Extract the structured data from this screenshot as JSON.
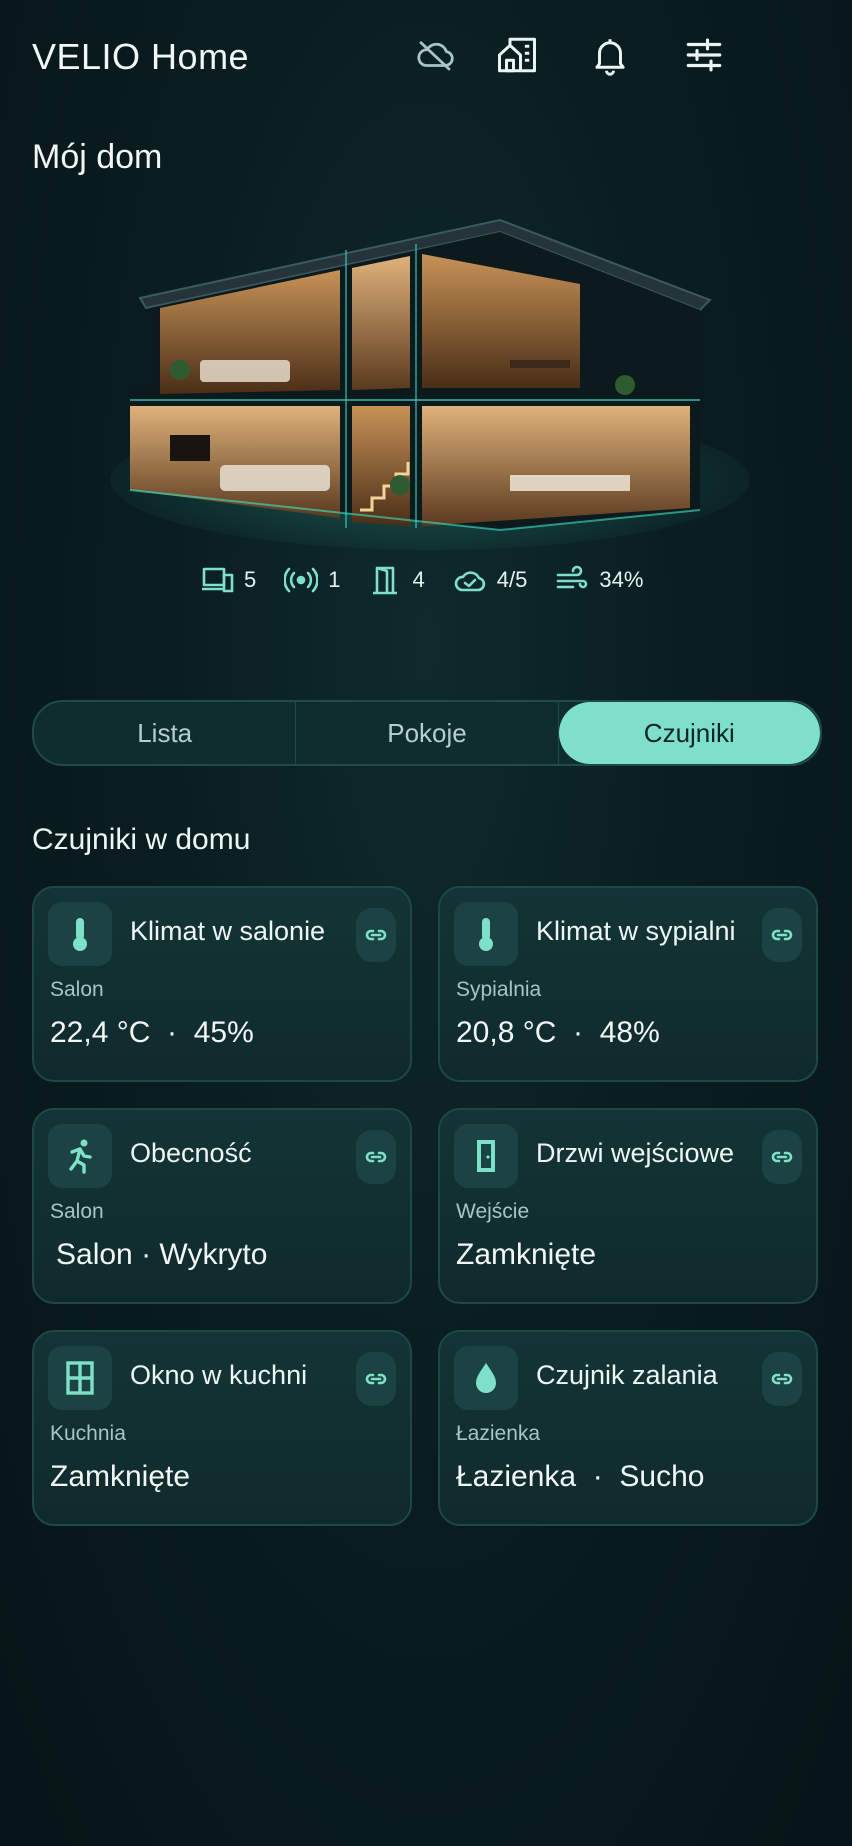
{
  "header": {
    "title": "VELIO Home",
    "icons": [
      "cloud-off-icon",
      "home-building-icon",
      "bell-icon",
      "sliders-icon"
    ]
  },
  "page_title": "Mój dom",
  "house_stats": [
    {
      "icon": "devices-icon",
      "value": "5"
    },
    {
      "icon": "broadcast-icon",
      "value": "1"
    },
    {
      "icon": "door-icon",
      "value": "4"
    },
    {
      "icon": "cloud-check-icon",
      "value": "4/5"
    },
    {
      "icon": "wind-icon",
      "value": "34%"
    }
  ],
  "tabs": [
    {
      "label": "Lista",
      "active": false
    },
    {
      "label": "Pokoje",
      "active": false
    },
    {
      "label": "Czujniki",
      "active": true
    }
  ],
  "section_title": "Czujniki w domu",
  "sensors": [
    {
      "icon": "thermometer-icon",
      "name": "Klimat w salonie",
      "room": "Salon",
      "value": "22,4 °C  ·  45%"
    },
    {
      "icon": "thermometer-icon",
      "name": "Klimat w sypialni",
      "room": "Sypialnia",
      "value": "20,8 °C  ·  48%"
    },
    {
      "icon": "person-running-icon",
      "name": "Obecność",
      "room": "Salon",
      "value": "Salon · Wykryto"
    },
    {
      "icon": "door-icon",
      "name": "Drzwi wejściowe",
      "room": "Wejście",
      "value": "Zamknięte"
    },
    {
      "icon": "window-icon",
      "name": "Okno w kuchni",
      "room": "Kuchnia",
      "value": "Zamknięte"
    },
    {
      "icon": "water-drop-icon",
      "name": "Czujnik zalania",
      "room": "Łazienka",
      "value": "Łazienka  ·  Sucho"
    }
  ],
  "colors": {
    "accent": "#7ee0c8",
    "background": "#0a1d20",
    "card": "#133436"
  }
}
